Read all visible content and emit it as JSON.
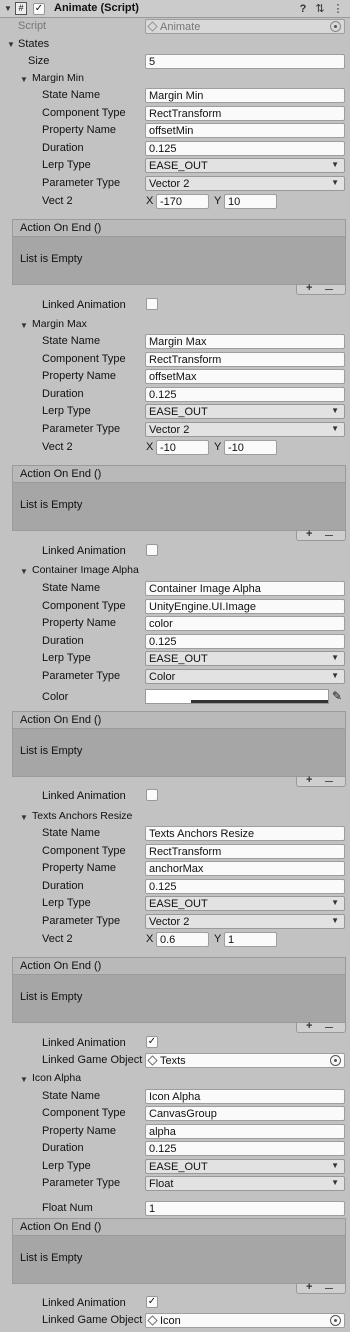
{
  "header": {
    "title": "Animate (Script)",
    "script_label": "Script",
    "script_value": "Animate"
  },
  "states_label": "States",
  "size_label": "Size",
  "size_value": "5",
  "labels": {
    "state_name": "State Name",
    "component_type": "Component Type",
    "property_name": "Property Name",
    "duration": "Duration",
    "lerp_type": "Lerp Type",
    "parameter_type": "Parameter Type",
    "vect2": "Vect 2",
    "color": "Color",
    "float_num": "Float Num",
    "action_on_end": "Action On End ()",
    "list_empty": "List is Empty",
    "linked_animation": "Linked Animation",
    "linked_game_object": "Linked Game Object",
    "x": "X",
    "y": "Y",
    "plus": "+",
    "minus": "—"
  },
  "states": [
    {
      "foldout": "Margin Min",
      "state_name": "Margin Min",
      "component_type": "RectTransform",
      "property_name": "offsetMin",
      "duration": "0.125",
      "lerp_type": "EASE_OUT",
      "parameter_type": "Vector 2",
      "x": "-170",
      "y": "10"
    },
    {
      "foldout": "Margin Max",
      "state_name": "Margin Max",
      "component_type": "RectTransform",
      "property_name": "offsetMax",
      "duration": "0.125",
      "lerp_type": "EASE_OUT",
      "parameter_type": "Vector 2",
      "x": "-10",
      "y": "-10"
    },
    {
      "foldout": "Container Image Alpha",
      "state_name": "Container Image Alpha",
      "component_type": "UnityEngine.UI.Image",
      "property_name": "color",
      "duration": "0.125",
      "lerp_type": "EASE_OUT",
      "parameter_type": "Color"
    },
    {
      "foldout": "Texts Anchors Resize",
      "state_name": "Texts Anchors Resize",
      "component_type": "RectTransform",
      "property_name": "anchorMax",
      "duration": "0.125",
      "lerp_type": "EASE_OUT",
      "parameter_type": "Vector 2",
      "x": "0.6",
      "y": "1",
      "linked_object": "Texts"
    },
    {
      "foldout": "Icon Alpha",
      "state_name": "Icon Alpha",
      "component_type": "CanvasGroup",
      "property_name": "alpha",
      "duration": "0.125",
      "lerp_type": "EASE_OUT",
      "parameter_type": "Float",
      "float_num": "1",
      "linked_object": "Icon"
    }
  ],
  "colors": {
    "panel": "#c2c2c2",
    "field": "#fafafa",
    "list_body": "#a6a6a6"
  }
}
